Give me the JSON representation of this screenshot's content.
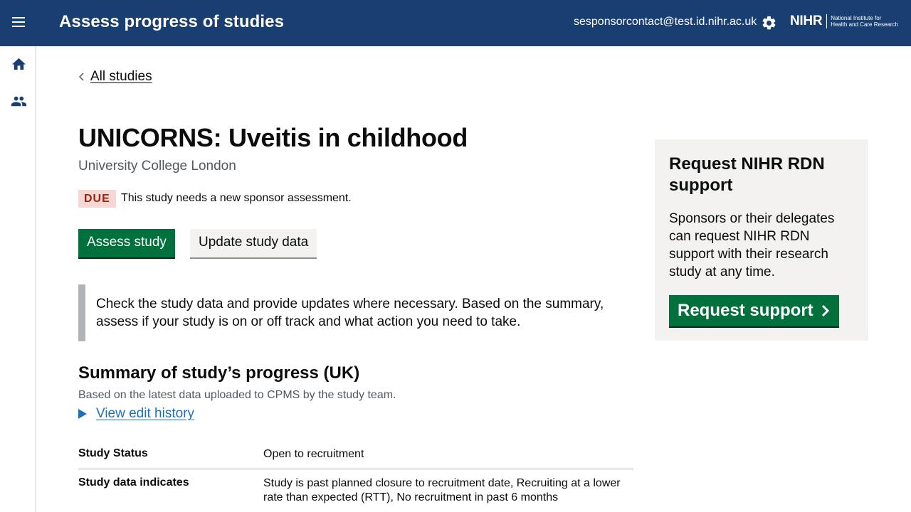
{
  "header": {
    "app_title": "Assess progress of studies",
    "user_email": "sesponsorcontact@test.id.nihr.ac.uk",
    "logo_word": "NIHR",
    "logo_subtitle": "National Institute for Health and Care Research",
    "menu_icon": "hamburger-menu-icon",
    "settings_icon": "gear-icon",
    "background_color": "#193e72"
  },
  "sidebar": {
    "items": [
      {
        "icon": "home-icon"
      },
      {
        "icon": "users-icon"
      }
    ]
  },
  "breadcrumb": {
    "label": "All studies"
  },
  "study": {
    "title": "UNICORNS: Uveitis in childhood",
    "organisation": "University College London",
    "status_tag": "DUE",
    "status_message": "This study needs a new sponsor assessment."
  },
  "actions": {
    "assess_label": "Assess study",
    "update_label": "Update study data"
  },
  "inset_text": "Check the study data and provide updates where necessary. Based on the summary, assess if your study is on or off track and what action you need to take.",
  "summary": {
    "heading": "Summary of study’s progress (UK)",
    "subtext": "Based on the latest data uploaded to CPMS by the study team.",
    "history_link": "View edit history",
    "rows": [
      {
        "key": "Study Status",
        "value": "Open to recruitment"
      },
      {
        "key": "Study data indicates",
        "value": "Study is past planned closure to recruitment date, Recruiting at a lower rate than expected (RTT), No recruitment in past 6 months"
      }
    ]
  },
  "support_panel": {
    "heading": "Request NIHR RDN support",
    "body": "Sponsors or their delegates can request NIHR RDN support with their research study at any time.",
    "button_label": "Request support"
  },
  "colors": {
    "primary_green": "#00703c",
    "link_blue": "#1d70b8",
    "due_tag_bg": "#f6d7d2",
    "due_tag_text": "#942514"
  }
}
